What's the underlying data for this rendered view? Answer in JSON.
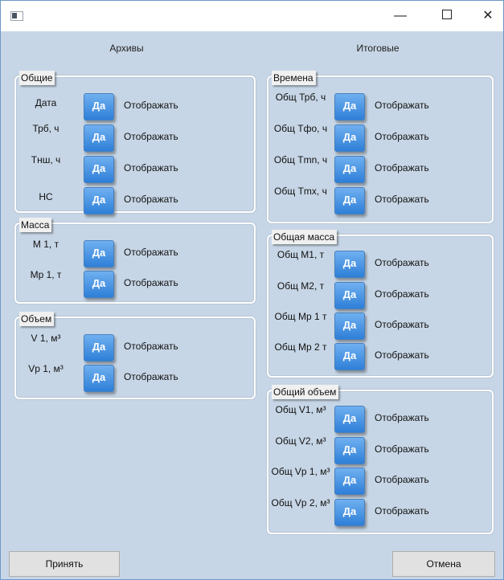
{
  "window": {
    "title": "",
    "controls": {
      "minimize": "—",
      "maximize": "",
      "close": "✕"
    }
  },
  "left": {
    "heading": "Архивы",
    "groups": [
      {
        "title": "Общие",
        "rows": [
          {
            "label": "Дата",
            "button": "Да",
            "value": "Отображать"
          },
          {
            "label": "Трб, ч",
            "button": "Да",
            "value": "Отображать"
          },
          {
            "label": "Тнш, ч",
            "button": "Да",
            "value": "Отображать"
          },
          {
            "label": "НС",
            "button": "Да",
            "value": "Отображать"
          }
        ]
      },
      {
        "title": "Масса",
        "rows": [
          {
            "label": "М 1, т",
            "button": "Да",
            "value": "Отображать"
          },
          {
            "label": "Мр 1, т",
            "button": "Да",
            "value": "Отображать"
          }
        ]
      },
      {
        "title": "Объем",
        "rows": [
          {
            "label": "V 1, м³",
            "button": "Да",
            "value": "Отображать"
          },
          {
            "label": "Vp 1, м³",
            "button": "Да",
            "value": "Отображать"
          }
        ]
      }
    ]
  },
  "right": {
    "heading": "Итоговые",
    "groups": [
      {
        "title": "Времена",
        "rows": [
          {
            "label": "Общ Трб, ч",
            "button": "Да",
            "value": "Отображать"
          },
          {
            "label": "Общ Тфо, ч",
            "button": "Да",
            "value": "Отображать"
          },
          {
            "label": "Общ Tmn, ч",
            "button": "Да",
            "value": "Отображать"
          },
          {
            "label": "Общ Tmx, ч",
            "button": "Да",
            "value": "Отображать"
          }
        ]
      },
      {
        "title": "Общая масса",
        "rows": [
          {
            "label": "Общ М1, т",
            "button": "Да",
            "value": "Отображать"
          },
          {
            "label": "Общ М2, т",
            "button": "Да",
            "value": "Отображать"
          },
          {
            "label": "Общ Мр 1 т",
            "button": "Да",
            "value": "Отображать"
          },
          {
            "label": "Общ Мр 2 т",
            "button": "Да",
            "value": "Отображать"
          }
        ]
      },
      {
        "title": "Общий объем",
        "rows": [
          {
            "label": "Общ V1, м³",
            "button": "Да",
            "value": "Отображать"
          },
          {
            "label": "Общ V2, м³",
            "button": "Да",
            "value": "Отображать"
          },
          {
            "label": "Общ Vp 1, м³",
            "button": "Да",
            "value": "Отображать"
          },
          {
            "label": "Общ Vp 2, м³",
            "button": "Да",
            "value": "Отображать"
          }
        ]
      }
    ]
  },
  "footer": {
    "accept": "Принять",
    "cancel": "Отмена"
  },
  "colors": {
    "accent": "#2e7fd8",
    "panel": "#c7d6e6",
    "titlebar": "#ffffff"
  },
  "icons": {
    "app": "window-icon",
    "min": "minimize-icon",
    "max": "maximize-icon",
    "close": "close-icon"
  }
}
